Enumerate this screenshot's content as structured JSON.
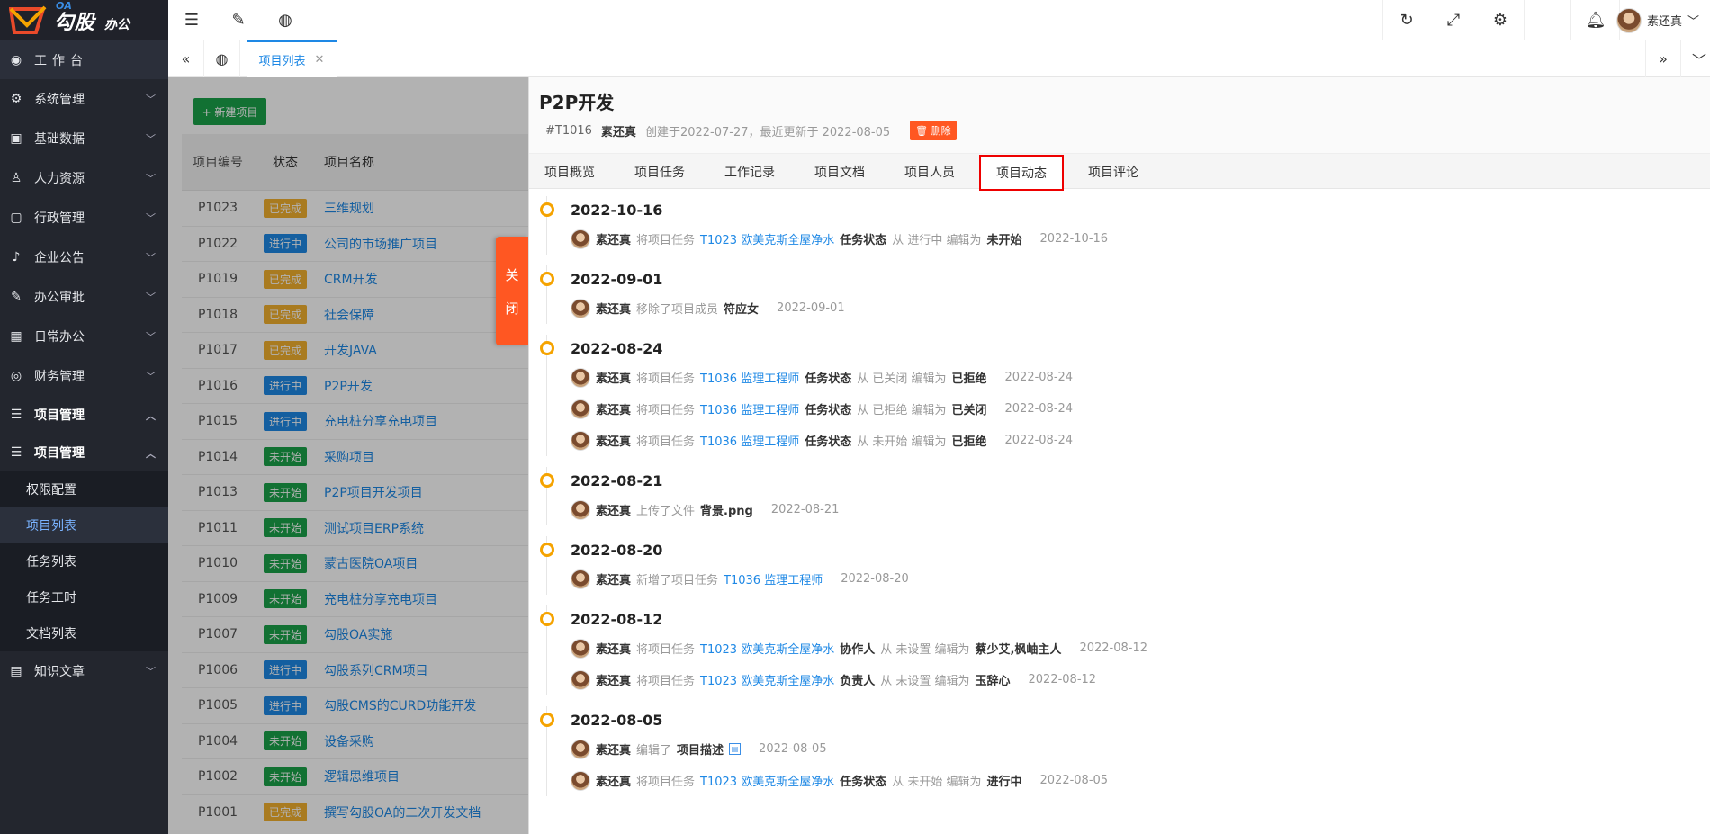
{
  "brand": {
    "name": "勾股",
    "sub": "办公",
    "oa": "OA"
  },
  "sidebar": {
    "workbench": "工作台",
    "items": [
      {
        "label": "系统管理"
      },
      {
        "label": "基础数据"
      },
      {
        "label": "人力资源"
      },
      {
        "label": "行政管理"
      },
      {
        "label": "企业公告"
      },
      {
        "label": "办公审批"
      },
      {
        "label": "日常办公"
      },
      {
        "label": "财务管理"
      }
    ],
    "project1": "项目管理",
    "project2": "项目管理",
    "sub": [
      {
        "label": "权限配置"
      },
      {
        "label": "项目列表"
      },
      {
        "label": "任务列表"
      },
      {
        "label": "任务工时"
      },
      {
        "label": "文档列表"
      }
    ],
    "knowledge": "知识文章"
  },
  "header": {
    "user": "素还真"
  },
  "tabs": {
    "current": "项目列表"
  },
  "list": {
    "new_button": "+ 新建项目",
    "headers": [
      "项目编号",
      "状态",
      "项目名称"
    ],
    "rows": [
      {
        "id": "P1023",
        "status": "已完成",
        "name": "三维规划"
      },
      {
        "id": "P1022",
        "status": "进行中",
        "name": "公司的市场推广项目"
      },
      {
        "id": "P1019",
        "status": "已完成",
        "name": "CRM开发"
      },
      {
        "id": "P1018",
        "status": "已完成",
        "name": "社会保障"
      },
      {
        "id": "P1017",
        "status": "已完成",
        "name": "开发JAVA"
      },
      {
        "id": "P1016",
        "status": "进行中",
        "name": "P2P开发"
      },
      {
        "id": "P1015",
        "status": "进行中",
        "name": "充电桩分享充电项目"
      },
      {
        "id": "P1014",
        "status": "未开始",
        "name": "采购项目"
      },
      {
        "id": "P1013",
        "status": "未开始",
        "name": "P2P项目开发项目"
      },
      {
        "id": "P1011",
        "status": "未开始",
        "name": "测试项目ERP系统"
      },
      {
        "id": "P1010",
        "status": "未开始",
        "name": "蒙古医院OA项目"
      },
      {
        "id": "P1009",
        "status": "未开始",
        "name": "充电桩分享充电项目"
      },
      {
        "id": "P1007",
        "status": "未开始",
        "name": "勾股OA实施"
      },
      {
        "id": "P1006",
        "status": "进行中",
        "name": "勾股系列CRM项目"
      },
      {
        "id": "P1005",
        "status": "进行中",
        "name": "勾股CMS的CURD功能开发"
      },
      {
        "id": "P1004",
        "status": "未开始",
        "name": "设备采购"
      },
      {
        "id": "P1002",
        "status": "未开始",
        "name": "逻辑思维项目"
      },
      {
        "id": "P1001",
        "status": "已完成",
        "name": "撰写勾股OA的二次开发文档"
      }
    ],
    "status_colors": {
      "已完成": "#f2b02f",
      "进行中": "#1e88e5",
      "未开始": "#1aa34a"
    }
  },
  "drawer": {
    "close_label": [
      "关",
      "闭"
    ],
    "title": "P2P开发",
    "code": "#T1016",
    "owner": "素还真",
    "created": "创建于2022-07-27，最近更新于 2022-08-05",
    "delete": "删除",
    "tabs": [
      "项目概览",
      "项目任务",
      "工作记录",
      "项目文档",
      "项目人员",
      "项目动态",
      "项目评论"
    ],
    "active_tab": "项目动态"
  },
  "timeline": [
    {
      "date": "2022-10-16",
      "logs": [
        [
          [
            "n",
            "素还真"
          ],
          [
            "g",
            "将项目任务"
          ],
          [
            "l",
            "T1023 欧美克斯全屋净水"
          ],
          [
            "b",
            "任务状态"
          ],
          [
            "g",
            "从 进行中 编辑为"
          ],
          [
            "b",
            "未开始"
          ],
          [
            "t",
            "2022-10-16"
          ]
        ]
      ]
    },
    {
      "date": "2022-09-01",
      "logs": [
        [
          [
            "n",
            "素还真"
          ],
          [
            "g",
            "移除了项目成员"
          ],
          [
            "b",
            "符应女"
          ],
          [
            "t",
            "2022-09-01"
          ]
        ]
      ]
    },
    {
      "date": "2022-08-24",
      "logs": [
        [
          [
            "n",
            "素还真"
          ],
          [
            "g",
            "将项目任务"
          ],
          [
            "l",
            "T1036 监理工程师"
          ],
          [
            "b",
            "任务状态"
          ],
          [
            "g",
            "从 已关闭 编辑为"
          ],
          [
            "b",
            "已拒绝"
          ],
          [
            "t",
            "2022-08-24"
          ]
        ],
        [
          [
            "n",
            "素还真"
          ],
          [
            "g",
            "将项目任务"
          ],
          [
            "l",
            "T1036 监理工程师"
          ],
          [
            "b",
            "任务状态"
          ],
          [
            "g",
            "从 已拒绝 编辑为"
          ],
          [
            "b",
            "已关闭"
          ],
          [
            "t",
            "2022-08-24"
          ]
        ],
        [
          [
            "n",
            "素还真"
          ],
          [
            "g",
            "将项目任务"
          ],
          [
            "l",
            "T1036 监理工程师"
          ],
          [
            "b",
            "任务状态"
          ],
          [
            "g",
            "从 未开始 编辑为"
          ],
          [
            "b",
            "已拒绝"
          ],
          [
            "t",
            "2022-08-24"
          ]
        ]
      ]
    },
    {
      "date": "2022-08-21",
      "logs": [
        [
          [
            "n",
            "素还真"
          ],
          [
            "g",
            "上传了文件"
          ],
          [
            "b",
            "背景.png"
          ],
          [
            "t",
            "2022-08-21"
          ]
        ]
      ]
    },
    {
      "date": "2022-08-20",
      "logs": [
        [
          [
            "n",
            "素还真"
          ],
          [
            "g",
            "新增了项目任务"
          ],
          [
            "l",
            "T1036 监理工程师"
          ],
          [
            "t",
            "2022-08-20"
          ]
        ]
      ]
    },
    {
      "date": "2022-08-12",
      "logs": [
        [
          [
            "n",
            "素还真"
          ],
          [
            "g",
            "将项目任务"
          ],
          [
            "l",
            "T1023 欧美克斯全屋净水"
          ],
          [
            "b",
            "协作人"
          ],
          [
            "g",
            "从 未设置 编辑为"
          ],
          [
            "b",
            "蔡少艾,枫岫主人"
          ],
          [
            "t",
            "2022-08-12"
          ]
        ],
        [
          [
            "n",
            "素还真"
          ],
          [
            "g",
            "将项目任务"
          ],
          [
            "l",
            "T1023 欧美克斯全屋净水"
          ],
          [
            "b",
            "负责人"
          ],
          [
            "g",
            "从 未设置 编辑为"
          ],
          [
            "b",
            "玉辞心"
          ],
          [
            "t",
            "2022-08-12"
          ]
        ]
      ]
    },
    {
      "date": "2022-08-05",
      "logs": [
        [
          [
            "n",
            "素还真"
          ],
          [
            "g",
            "编辑了"
          ],
          [
            "b",
            "项目描述"
          ],
          [
            "d",
            ""
          ],
          [
            "t",
            "2022-08-05"
          ]
        ],
        [
          [
            "n",
            "素还真"
          ],
          [
            "g",
            "将项目任务"
          ],
          [
            "l",
            "T1023 欧美克斯全屋净水"
          ],
          [
            "b",
            "任务状态"
          ],
          [
            "g",
            "从 未开始 编辑为"
          ],
          [
            "b",
            "进行中"
          ],
          [
            "t",
            "2022-08-05"
          ]
        ]
      ]
    }
  ]
}
